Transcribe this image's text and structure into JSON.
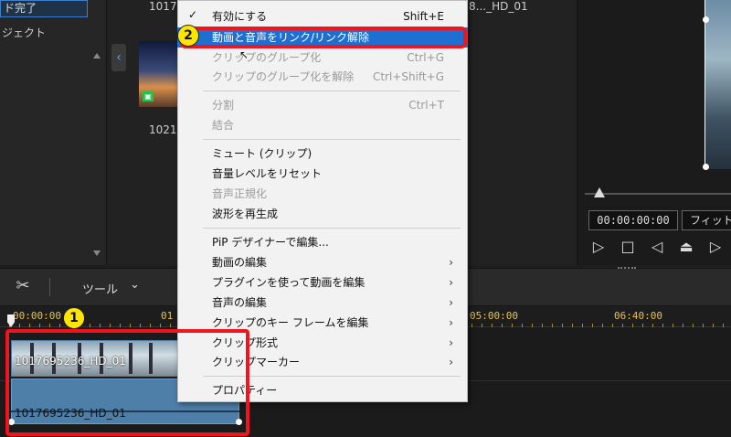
{
  "library": {
    "folder_upload": "ド完了",
    "folder_project": "ジェクト",
    "thumb_label_top": "1017",
    "thumb_label_1021": "1021",
    "thumb_label_right": "8..._HD_01"
  },
  "preview": {
    "timecode": "00:00:00:00",
    "fit_label": "フィット"
  },
  "toolbar": {
    "tools_label": "ツール"
  },
  "timeline": {
    "ticks": [
      "00:00:00",
      "01",
      "05:00:00",
      "06:40:00"
    ],
    "video_clip_label": "1017695236_HD_01",
    "audio_clip_label": "1017695236_HD_01"
  },
  "badges": {
    "one": "1",
    "two": "2"
  },
  "menu": {
    "items": [
      {
        "label": "有効にする",
        "shortcut": "Shift+E"
      },
      {
        "label": "動画と音声をリンク/リンク解除",
        "shortcut": ""
      },
      {
        "label": "クリップのグループ化",
        "shortcut": "Ctrl+G"
      },
      {
        "label": "クリップのグループ化を解除",
        "shortcut": "Ctrl+Shift+G"
      },
      {
        "label": "分割",
        "shortcut": "Ctrl+T"
      },
      {
        "label": "結合",
        "shortcut": ""
      },
      {
        "label": "ミュート (クリップ)",
        "shortcut": ""
      },
      {
        "label": "音量レベルをリセット",
        "shortcut": ""
      },
      {
        "label": "音声正規化",
        "shortcut": ""
      },
      {
        "label": "波形を再生成",
        "shortcut": ""
      },
      {
        "label": "PiP デザイナーで編集...",
        "shortcut": ""
      },
      {
        "label": "動画の編集",
        "shortcut": ""
      },
      {
        "label": "プラグインを使って動画を編集",
        "shortcut": ""
      },
      {
        "label": "音声の編集",
        "shortcut": ""
      },
      {
        "label": "クリップのキー フレームを編集",
        "shortcut": ""
      },
      {
        "label": "クリップ形式",
        "shortcut": ""
      },
      {
        "label": "クリップマーカー",
        "shortcut": ""
      },
      {
        "label": "プロパティー",
        "shortcut": ""
      }
    ]
  },
  "colors": {
    "accent": "#1f6fd1",
    "highlight_red": "#f0141e",
    "badge_yellow": "#ffe600",
    "clip_blue": "#4e7fa8"
  }
}
